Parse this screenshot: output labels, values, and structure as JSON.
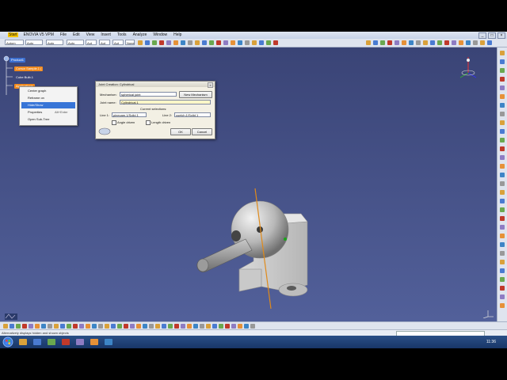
{
  "app": {
    "title": "ENOVIA V5 VPM",
    "menu": [
      "Start",
      "ENOVIA V5 VPM",
      "File",
      "Edit",
      "View",
      "Insert",
      "Tools",
      "Analyze",
      "Window",
      "Help"
    ],
    "window_controls": [
      "_",
      "□",
      "×"
    ]
  },
  "toolbar": {
    "dropdowns": [
      "Autom",
      "Auto",
      "Auto",
      "Auto",
      "Aut",
      "Aut",
      "Aut",
      "None"
    ]
  },
  "tree": {
    "nodes": [
      "Product1",
      "Cursor Sample.1 (",
      "Cube Bulb.1",
      "Applications"
    ]
  },
  "context_menu": {
    "items": [
      {
        "label": "Center graph",
        "hint": ""
      },
      {
        "label": "Reframe on",
        "hint": ""
      },
      {
        "label": "Hide/Show",
        "hint": ""
      },
      {
        "label": "Properties",
        "hint": "Alt+Enter"
      },
      {
        "label": "Open Sub-Tree",
        "hint": ""
      }
    ],
    "selected_index": 2
  },
  "dialog": {
    "title": "Joint Creation: Cylindrical",
    "mechanism_label": "Mechanism:",
    "mechanism_value": "spherical joint",
    "new_mechanism_button": "New Mechanism",
    "joint_name_label": "Joint name:",
    "joint_name_value": "Cylindrical.1",
    "current_selections_label": "Current selections:",
    "line1_label": "Line 1:",
    "line1_value": "pinecam.1/Solid.1",
    "line2_label": "Line 2:",
    "line2_value": "cuelch.1/Solid.1",
    "angle_driven_label": "Angle driven",
    "length_driven_label": "Length driven",
    "ok_button": "OK",
    "cancel_button": "Cancel"
  },
  "status": {
    "message": "Alternatively displays hidden and shown objects"
  },
  "taskbar": {
    "clock": "11:36"
  },
  "colors": {
    "viewport_top": "#3a4476",
    "viewport_bottom": "#52609a",
    "selection": "#3875d7",
    "tree_highlight": "#f08a1e",
    "axis_orange": "#e08a1a"
  }
}
